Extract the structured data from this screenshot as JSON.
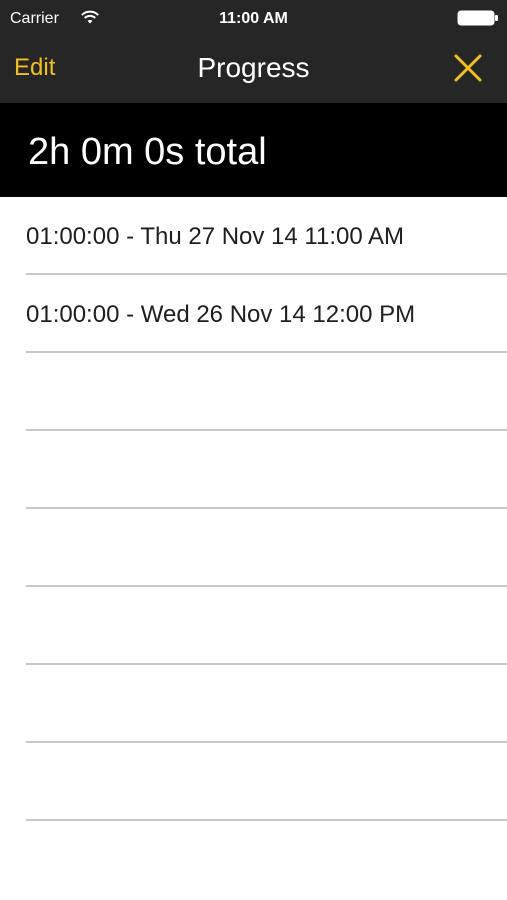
{
  "status_bar": {
    "carrier": "Carrier",
    "time": "11:00 AM"
  },
  "nav": {
    "edit_label": "Edit",
    "title": "Progress",
    "close_icon": "close-x-icon"
  },
  "summary": {
    "total": "2h 0m 0s total"
  },
  "entries": [
    "01:00:00 - Thu 27 Nov 14 11:00 AM",
    "01:00:00 - Wed 26 Nov 14 12:00 PM",
    "",
    "",
    "",
    "",
    "",
    ""
  ],
  "colors": {
    "accent": "#f2c01e",
    "nav_background": "#262626",
    "header_background": "#000000"
  }
}
